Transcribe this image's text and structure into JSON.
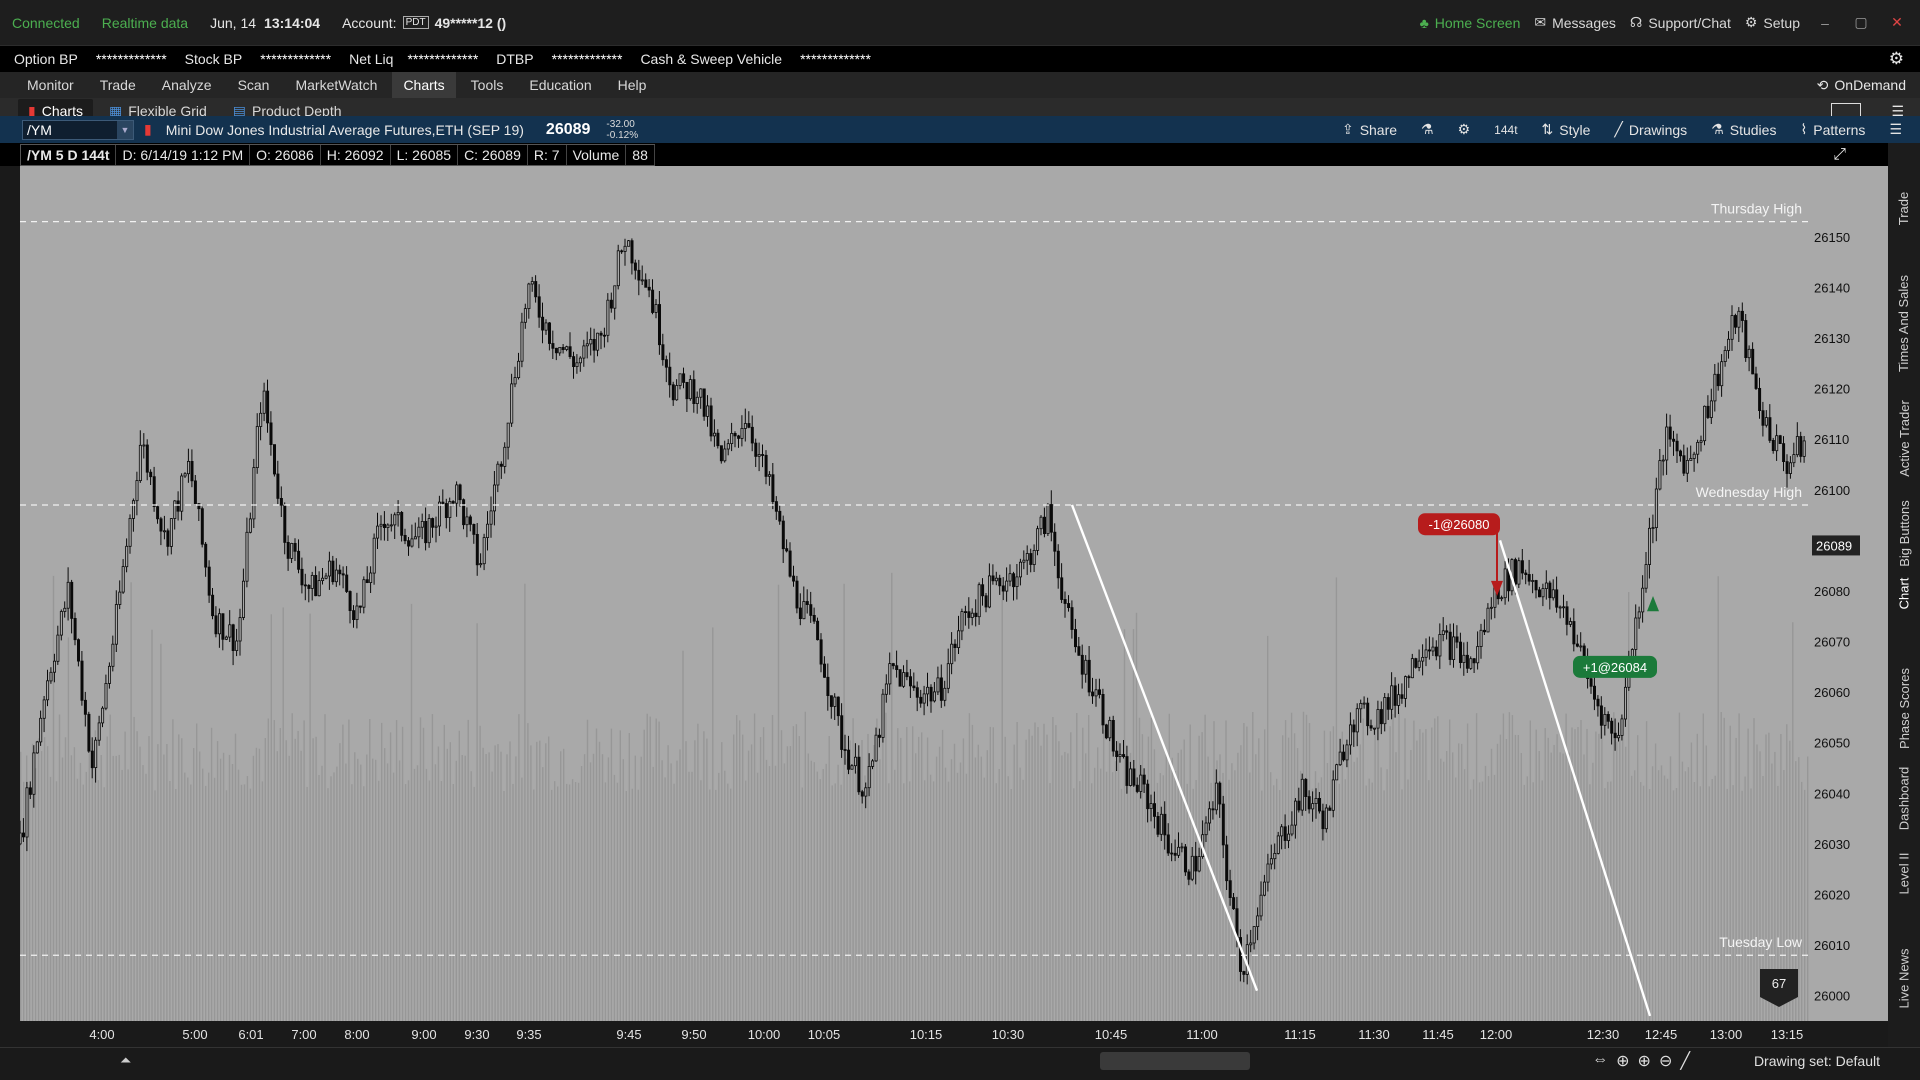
{
  "status_bar": {
    "connected": "Connected",
    "realtime": "Realtime data",
    "date": "Jun, 14",
    "time": "13:14:04",
    "account_label": "Account:",
    "account_badge": "PDT",
    "account_value": "49*****12 ()",
    "home": "Home Screen",
    "messages": "Messages",
    "support": "Support/Chat",
    "setup": "Setup"
  },
  "bp_bar": {
    "option_bp_label": "Option BP",
    "option_bp": "*************",
    "stock_bp_label": "Stock BP",
    "stock_bp": "*************",
    "net_liq_label": "Net Liq",
    "net_liq": "*************",
    "dtbp_label": "DTBP",
    "dtbp": "*************",
    "cash_label": "Cash & Sweep Vehicle",
    "cash": "*************"
  },
  "menu": {
    "items": [
      "Monitor",
      "Trade",
      "Analyze",
      "Scan",
      "MarketWatch",
      "Charts",
      "Tools",
      "Education",
      "Help"
    ],
    "active": "Charts",
    "ondemand": "OnDemand"
  },
  "sub_tabs": [
    "Charts",
    "Flexible Grid",
    "Product Depth"
  ],
  "chart_toolbar": {
    "symbol": "/YM",
    "description": "Mini Dow Jones Industrial Average Futures,ETH (SEP 19)",
    "last": "26089",
    "change": "-32.00",
    "change_pct": "-0.12%",
    "share": "Share",
    "ticks": "144t",
    "style": "Style",
    "drawings": "Drawings",
    "studies": "Studies",
    "patterns": "Patterns"
  },
  "info_bar": {
    "cells": [
      "/YM 5 D 144t",
      "D: 6/14/19 1:12 PM",
      "O: 26086",
      "H: 26092",
      "L: 26085",
      "C: 26089",
      "R: 7",
      "Volume",
      "88"
    ]
  },
  "side_tabs": [
    "Trade",
    "Times And Sales",
    "Active Trader",
    "Big Buttons",
    "Chart",
    "Phase Scores",
    "Dashboard",
    "Level II",
    "Live News"
  ],
  "chart_data": {
    "type": "candlestick",
    "y_ticks": [
      26150,
      26140,
      26130,
      26120,
      26110,
      26100,
      26090,
      26080,
      26070,
      26060,
      26050,
      26040,
      26030,
      26020,
      26010,
      26000
    ],
    "y_labels": [
      "26150",
      "26140",
      "26130",
      "26120",
      "26110",
      "26100",
      "",
      "26080",
      "26070",
      "26060",
      "26050",
      "26040",
      "26030",
      "26020",
      "26010",
      "26000"
    ],
    "ylim": [
      25995,
      26164
    ],
    "x_labels": [
      "4:00",
      "5:00",
      "6:01",
      "7:00",
      "8:00",
      "9:00",
      "9:30",
      "9:35",
      "9:45",
      "9:50",
      "10:00",
      "10:05",
      "10:15",
      "10:30",
      "10:45",
      "11:00",
      "11:15",
      "11:30",
      "11:45",
      "12:00",
      "12:30",
      "12:45",
      "13:00",
      "13:15"
    ],
    "price_path": [
      [
        0,
        26030
      ],
      [
        20,
        26060
      ],
      [
        40,
        26080
      ],
      [
        60,
        26045
      ],
      [
        80,
        26075
      ],
      [
        100,
        26110
      ],
      [
        120,
        26090
      ],
      [
        140,
        26105
      ],
      [
        160,
        26075
      ],
      [
        180,
        26070
      ],
      [
        200,
        26120
      ],
      [
        220,
        26090
      ],
      [
        240,
        26080
      ],
      [
        260,
        26085
      ],
      [
        280,
        26075
      ],
      [
        300,
        26095
      ],
      [
        330,
        26090
      ],
      [
        360,
        26100
      ],
      [
        380,
        26085
      ],
      [
        400,
        26110
      ],
      [
        420,
        26140
      ],
      [
        440,
        26130
      ],
      [
        460,
        26125
      ],
      [
        480,
        26130
      ],
      [
        500,
        26150
      ],
      [
        520,
        26140
      ],
      [
        540,
        26120
      ],
      [
        560,
        26120
      ],
      [
        580,
        26105
      ],
      [
        600,
        26115
      ],
      [
        620,
        26100
      ],
      [
        640,
        26080
      ],
      [
        660,
        26070
      ],
      [
        680,
        26050
      ],
      [
        700,
        26040
      ],
      [
        720,
        26065
      ],
      [
        740,
        26060
      ],
      [
        760,
        26060
      ],
      [
        780,
        26075
      ],
      [
        800,
        26080
      ],
      [
        830,
        26085
      ],
      [
        850,
        26095
      ],
      [
        870,
        26070
      ],
      [
        890,
        26060
      ],
      [
        910,
        26045
      ],
      [
        930,
        26040
      ],
      [
        950,
        26030
      ],
      [
        970,
        26025
      ],
      [
        990,
        26040
      ],
      [
        1000,
        26020
      ],
      [
        1010,
        26005
      ],
      [
        1020,
        26015
      ],
      [
        1040,
        26030
      ],
      [
        1060,
        26040
      ],
      [
        1080,
        26035
      ],
      [
        1100,
        26055
      ],
      [
        1120,
        26055
      ],
      [
        1140,
        26060
      ],
      [
        1160,
        26070
      ],
      [
        1180,
        26070
      ],
      [
        1200,
        26065
      ],
      [
        1220,
        26080
      ],
      [
        1240,
        26085
      ],
      [
        1260,
        26080
      ],
      [
        1280,
        26075
      ],
      [
        1300,
        26060
      ],
      [
        1320,
        26050
      ],
      [
        1340,
        26080
      ],
      [
        1360,
        26110
      ],
      [
        1380,
        26105
      ],
      [
        1400,
        26120
      ],
      [
        1420,
        26135
      ],
      [
        1440,
        26115
      ],
      [
        1460,
        26105
      ],
      [
        1478,
        26110
      ]
    ],
    "ref_lines": [
      {
        "label": "Thursday High",
        "value": 26153
      },
      {
        "label": "Wednesday High",
        "value": 26097
      },
      {
        "label": "Tuesday Low",
        "value": 26008
      }
    ],
    "price_tag": "26089",
    "price_tag_value": 26089,
    "orders": [
      {
        "label": "-1@26080",
        "color": "#b71c1c"
      },
      {
        "label": "+1@26084",
        "color": "#1b7a3a"
      }
    ],
    "volume_badge": "67"
  },
  "bottom_bar": {
    "drawing_set": "Drawing set: Default"
  }
}
